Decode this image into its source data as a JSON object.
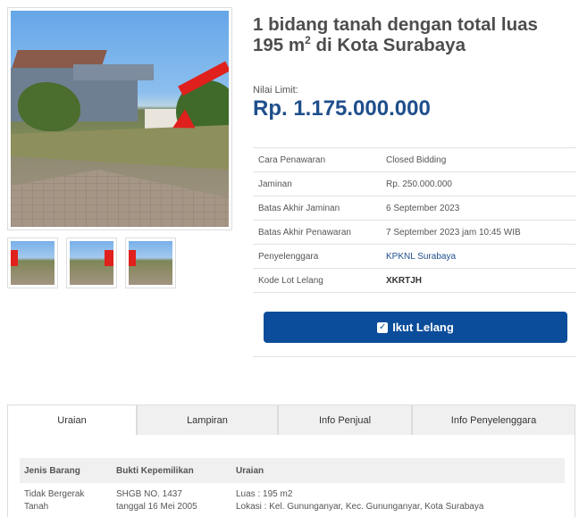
{
  "listing": {
    "title_main": "1 bidang tanah dengan total luas 195 m",
    "title_sup": "2",
    "title_tail": " di Kota Surabaya",
    "limit_label": "Nilai Limit:",
    "limit_value": "Rp. 1.175.000.000"
  },
  "info_rows": [
    {
      "label": "Cara Penawaran",
      "value": "Closed Bidding"
    },
    {
      "label": "Jaminan",
      "value": "Rp. 250.000.000"
    },
    {
      "label": "Batas Akhir Jaminan",
      "value": "6 September 2023"
    },
    {
      "label": "Batas Akhir Penawaran",
      "value": "7 September 2023 jam 10:45 WIB"
    },
    {
      "label": "Penyelenggara",
      "value": "KPKNL Surabaya"
    },
    {
      "label": "Kode Lot Lelang",
      "value": "XKRTJH"
    }
  ],
  "button": {
    "label": "Ikut Lelang"
  },
  "tabs": [
    "Uraian",
    "Lampiran",
    "Info Penjual",
    "Info Penyelenggara"
  ],
  "detail": {
    "headers": [
      "Jenis Barang",
      "Bukti Kepemilikan",
      "Uraian"
    ],
    "row": {
      "jenis_1": "Tidak Bergerak",
      "jenis_2": "Tanah",
      "bukti_1": "SHGB NO. 1437",
      "bukti_2": "tanggal 16 Mei 2005",
      "uraian_1": "Luas : 195 m2",
      "uraian_2": "Lokasi : Kel. Gununganyar, Kec. Gununganyar, Kota Surabaya"
    }
  },
  "icons": {
    "button_icon": "check-square-icon"
  },
  "colors": {
    "accent": "#0b4d9a",
    "price": "#1f4f8c",
    "arrow": "#e0201c"
  }
}
